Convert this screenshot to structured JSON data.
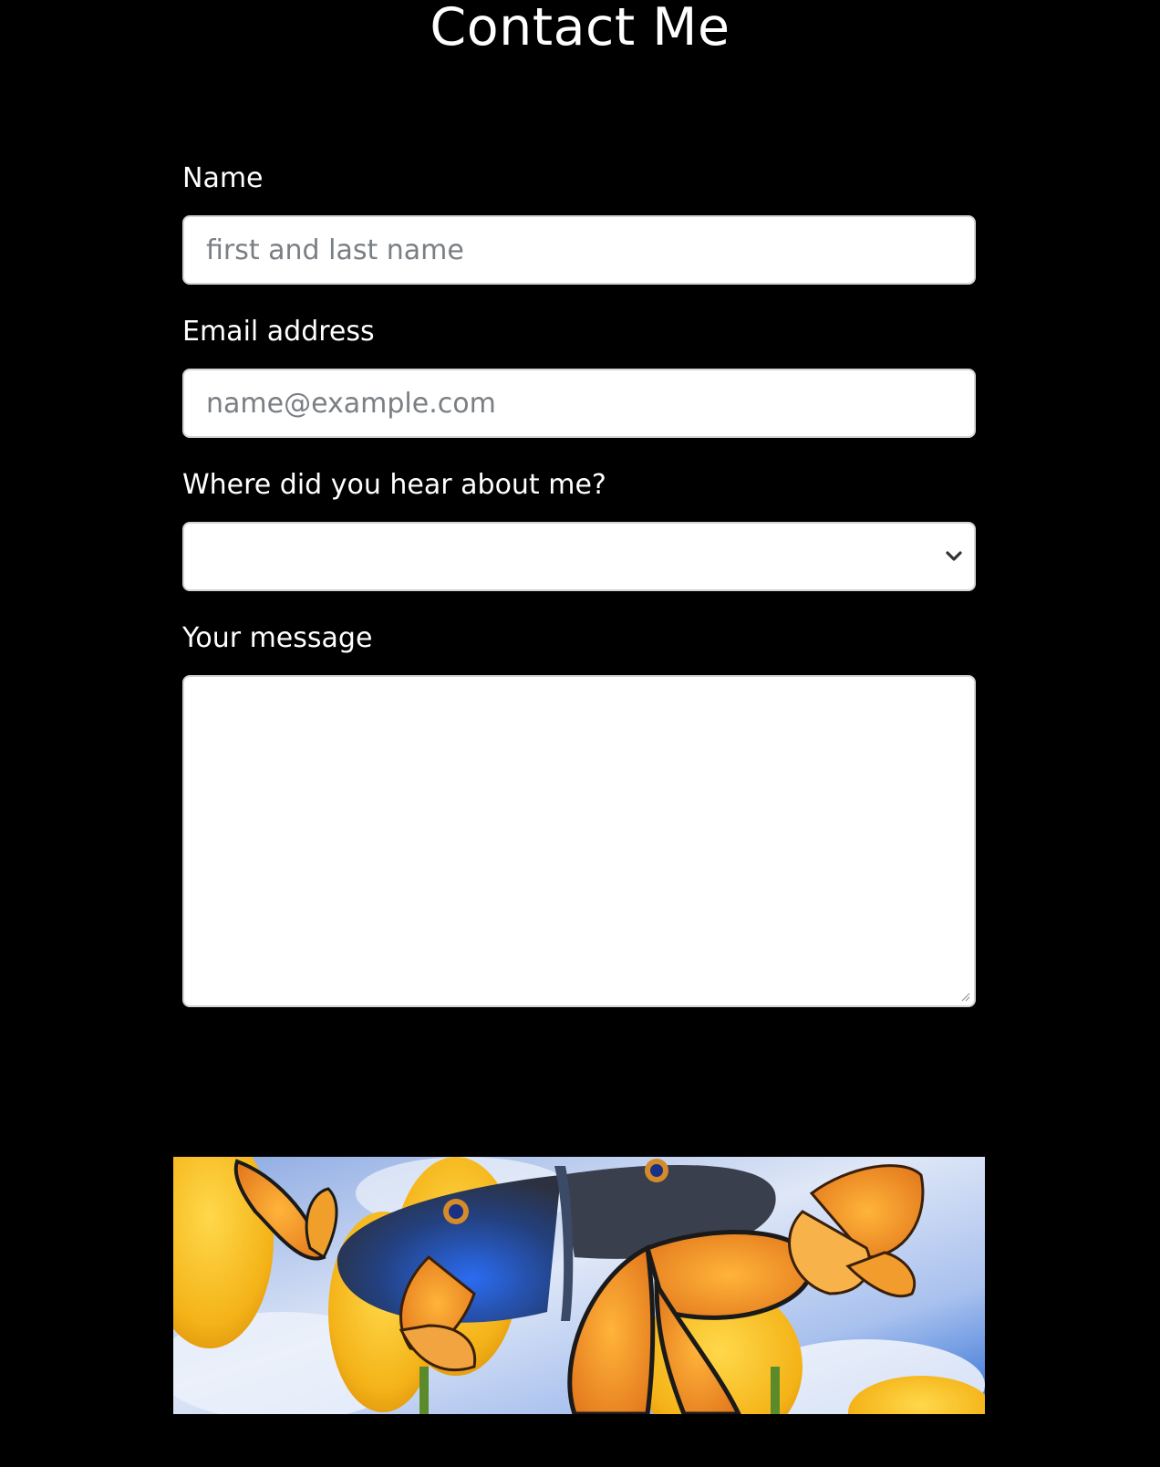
{
  "page": {
    "title": "Contact Me"
  },
  "form": {
    "name": {
      "label": "Name",
      "placeholder": "first and last name",
      "value": ""
    },
    "email": {
      "label": "Email address",
      "placeholder": "name@example.com",
      "value": ""
    },
    "referral": {
      "label": "Where did you hear about me?",
      "selected": ""
    },
    "message": {
      "label": "Your message",
      "value": ""
    }
  },
  "banner": {
    "subject": "butterflies over yellow tulips against a blue sky"
  },
  "colors": {
    "background": "#000000",
    "text": "#ffffff",
    "field_background": "#ffffff",
    "field_border": "#d4d4d4",
    "placeholder": "#7a7f85"
  }
}
